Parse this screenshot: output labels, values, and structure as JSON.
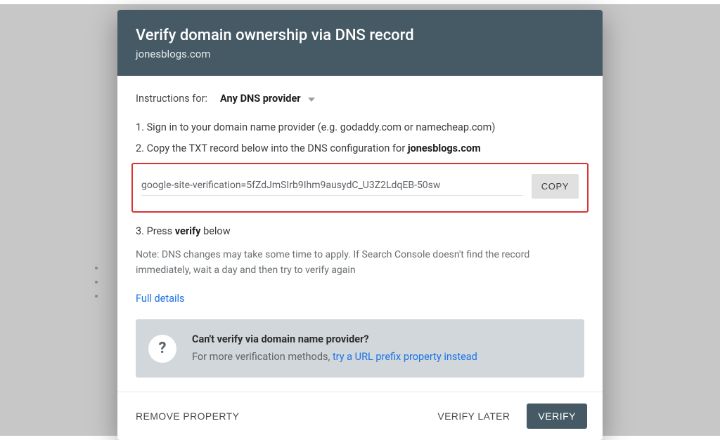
{
  "header": {
    "title": "Verify domain ownership via DNS record",
    "domain": "jonesblogs.com"
  },
  "body": {
    "instructions_label": "Instructions for:",
    "provider_selected": "Any DNS provider",
    "step1": "1. Sign in to your domain name provider (e.g. godaddy.com or namecheap.com)",
    "step2_prefix": "2. Copy the TXT record below into the DNS configuration for ",
    "step2_domain": "jonesblogs.com",
    "txt_record": "google-site-verification=5fZdJmSIrb9Ihm9ausydC_U3Z2LdqEB-50sw",
    "copy_label": "COPY",
    "step3_prefix": "3. Press ",
    "step3_bold": "verify",
    "step3_suffix": " below",
    "note": "Note: DNS changes may take some time to apply. If Search Console doesn't find the record immediately, wait a day and then try to verify again",
    "full_details": "Full details",
    "alt": {
      "heading": "Can't verify via domain name provider?",
      "sub": "For more verification methods, ",
      "link": "try a URL prefix property instead"
    }
  },
  "footer": {
    "remove": "REMOVE PROPERTY",
    "later": "VERIFY LATER",
    "verify": "VERIFY"
  }
}
